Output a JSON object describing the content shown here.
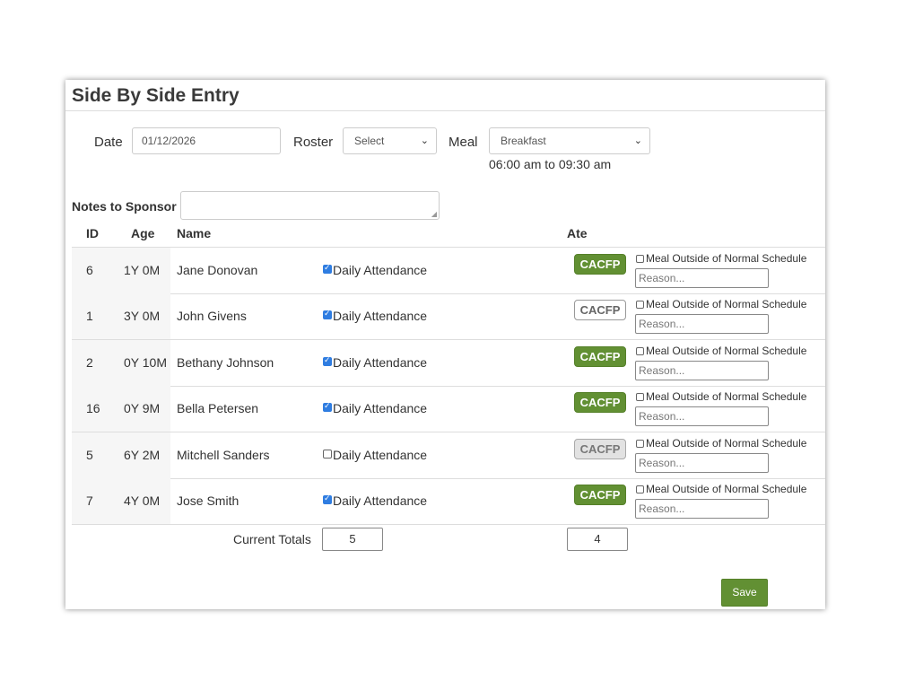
{
  "title": "Side By Side Entry",
  "filters": {
    "date_label": "Date",
    "date_value": "01/12/2026",
    "roster_label": "Roster",
    "roster_value": "Select",
    "meal_label": "Meal",
    "meal_value": "Breakfast",
    "meal_time": "06:00 am to 09:30 am"
  },
  "notes": {
    "label": "Notes to Sponsor",
    "value": ""
  },
  "table": {
    "headers": {
      "id": "ID",
      "age": "Age",
      "name": "Name",
      "ate": "Ate"
    },
    "attendance_label": "Daily Attendance",
    "cacfp_label": "CACFP",
    "meal_outside_label": "Meal Outside of Normal Schedule",
    "reason_placeholder": "Reason...",
    "rows": [
      {
        "id": "6",
        "age": "1Y 0M",
        "name": "Jane Donovan",
        "attendance": true,
        "cacfp_state": "selected"
      },
      {
        "id": "1",
        "age": "3Y 0M",
        "name": "John Givens",
        "attendance": true,
        "cacfp_state": "unselected"
      },
      {
        "id": "2",
        "age": "0Y 10M",
        "name": "Bethany Johnson",
        "attendance": true,
        "cacfp_state": "selected"
      },
      {
        "id": "16",
        "age": "0Y 9M",
        "name": "Bella Petersen",
        "attendance": true,
        "cacfp_state": "selected"
      },
      {
        "id": "5",
        "age": "6Y 2M",
        "name": "Mitchell Sanders",
        "attendance": false,
        "cacfp_state": "disabled"
      },
      {
        "id": "7",
        "age": "4Y 0M",
        "name": "Jose Smith",
        "attendance": true,
        "cacfp_state": "selected"
      }
    ]
  },
  "totals": {
    "label": "Current Totals",
    "attendance": "5",
    "ate": "4"
  },
  "save_label": "Save",
  "colors": {
    "accent_green": "#629033",
    "checkbox_blue": "#2f7de1"
  }
}
